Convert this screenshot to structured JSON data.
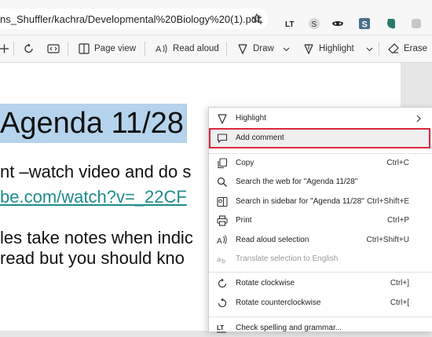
{
  "address_bar": {
    "url": "ns_Shuffler/kachra/Developmental%20Biology%20(1).pdf",
    "extensions": [
      "LT",
      "S",
      "mask",
      "S",
      "evernote"
    ]
  },
  "pdf_toolbar": {
    "page_view_label": "Page view",
    "read_aloud_label": "Read aloud",
    "draw_label": "Draw",
    "highlight_label": "Highlight",
    "erase_label": "Erase"
  },
  "document": {
    "heading_selected": "Agenda 11/28",
    "line2": "nt –watch video and do s",
    "line3": "be.com/watch?v=_22CF",
    "line4": "les take notes when indic",
    "line5": "read but you should kno"
  },
  "context_menu": {
    "items": [
      {
        "label": "Highlight",
        "shortcut": "",
        "submenu": true
      },
      {
        "label": "Add comment",
        "shortcut": ""
      },
      {
        "label": "Copy",
        "shortcut": "Ctrl+C"
      },
      {
        "label": "Search the web for \"Agenda 11/28\"",
        "shortcut": ""
      },
      {
        "label": "Search in sidebar for \"Agenda 11/28\"",
        "shortcut": "Ctrl+Shift+E"
      },
      {
        "label": "Print",
        "shortcut": "Ctrl+P"
      },
      {
        "label": "Read aloud selection",
        "shortcut": "Ctrl+Shift+U"
      },
      {
        "label": "Translate selection to English",
        "shortcut": "",
        "disabled": true
      },
      {
        "label": "Rotate clockwise",
        "shortcut": "Ctrl+]"
      },
      {
        "label": "Rotate counterclockwise",
        "shortcut": "Ctrl+["
      },
      {
        "label": "Check spelling and grammar...",
        "shortcut": ""
      }
    ]
  },
  "colors": {
    "selection": "#b5d3ec",
    "link": "#1f8c8c",
    "focus_outline": "#d9283e"
  }
}
